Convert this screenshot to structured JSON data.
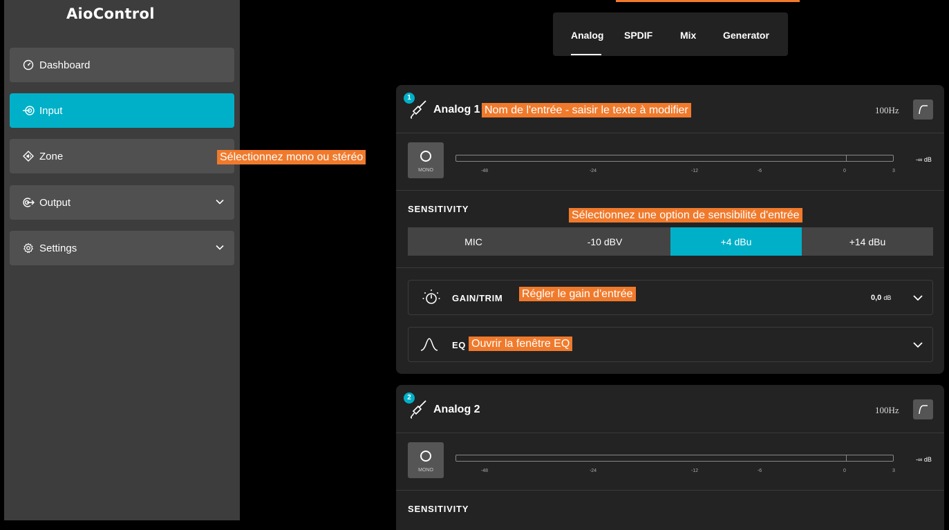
{
  "app": {
    "title": "AioControl"
  },
  "sidebar": {
    "items": [
      {
        "label": "Dashboard",
        "icon": "gauge-icon",
        "active": false
      },
      {
        "label": "Input",
        "icon": "input-icon",
        "active": true
      },
      {
        "label": "Zone",
        "icon": "speaker-icon",
        "active": false
      },
      {
        "label": "Output",
        "icon": "output-icon",
        "active": false,
        "expandable": true
      },
      {
        "label": "Settings",
        "icon": "gear-icon",
        "active": false,
        "expandable": true
      }
    ]
  },
  "tabs": [
    {
      "label": "Analog",
      "active": true
    },
    {
      "label": "SPDIF",
      "active": false
    },
    {
      "label": "Mix",
      "active": false
    },
    {
      "label": "Generator",
      "active": false
    }
  ],
  "channels": [
    {
      "number": "1",
      "name": "Analog 1",
      "highpass": "100Hz",
      "mono_label": "MONO",
      "meter_value": "-∞ dB",
      "meter_ticks": [
        "-48",
        "-24",
        "-12",
        "-6",
        "0",
        "3"
      ],
      "sensitivity_label": "SENSITIVITY",
      "sensitivity_options": [
        "MIC",
        "-10 dBV",
        "+4 dBu",
        "+14 dBu"
      ],
      "sensitivity_selected": "+4 dBu",
      "gain_label": "GAIN/TRIM",
      "gain_value": "0,0",
      "gain_unit": "dB",
      "eq_label": "EQ"
    },
    {
      "number": "2",
      "name": "Analog 2",
      "highpass": "100Hz",
      "mono_label": "MONO",
      "meter_value": "-∞ dB",
      "meter_ticks": [
        "-48",
        "-24",
        "-12",
        "-6",
        "0",
        "3"
      ],
      "sensitivity_label": "SENSITIVITY"
    }
  ],
  "annotations": {
    "name_hint": "Nom de l'entrée - saisir le texte à modifier",
    "mono_hint": "Sélectionnez mono ou stéréo",
    "sensitivity_hint": "Sélectionnez une option de sensibilité d'entrée",
    "gain_hint": "Régler le gain d'entrée",
    "eq_hint": "Ouvrir la fenêtre EQ"
  },
  "colors": {
    "accent": "#00b0c8",
    "annotation": "#f07a2c",
    "sidebar": "#3d3d3d",
    "card": "#232323"
  }
}
